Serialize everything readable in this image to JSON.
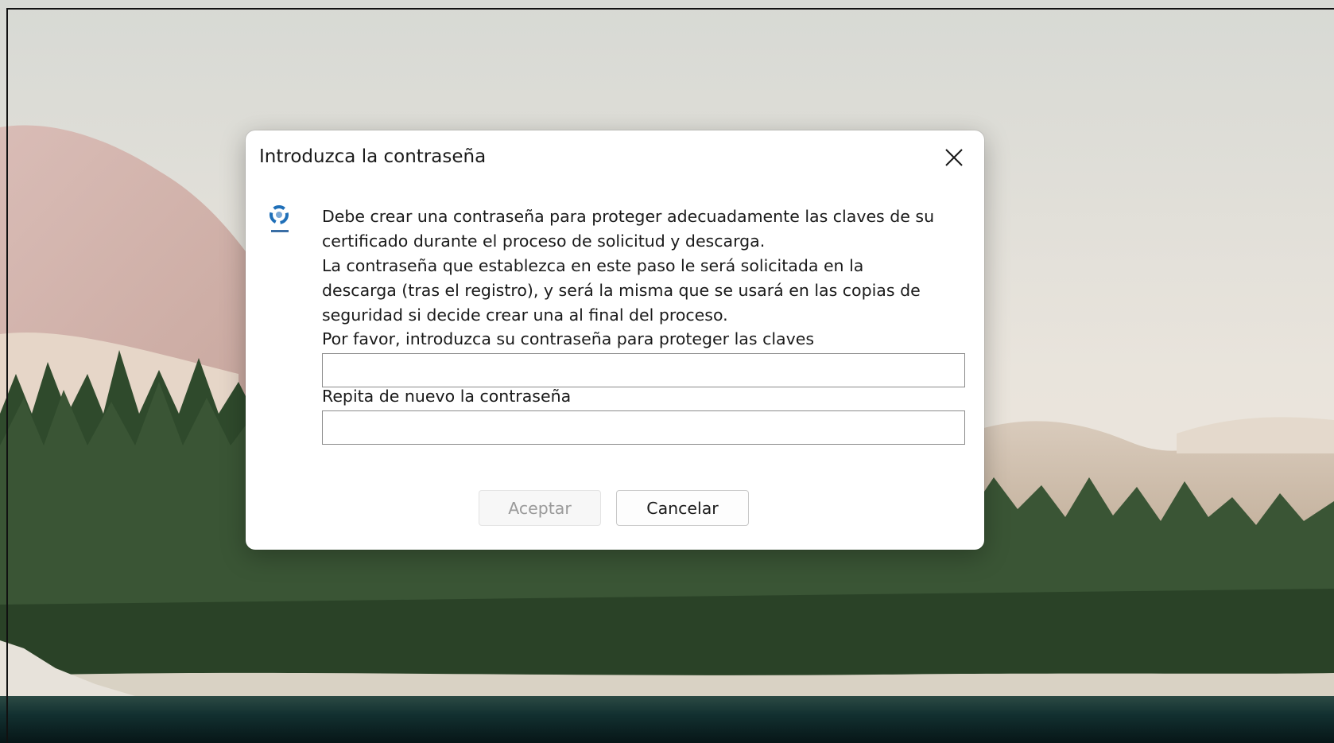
{
  "dialog": {
    "title": "Introduzca la contraseña",
    "close_icon": "close-icon",
    "app_icon": "certificate-app-icon",
    "message_lines": [
      "Debe crear una contraseña para proteger adecuadamente las claves de su",
      "certificado durante el proceso de solicitud y descarga.",
      "La contraseña que establezca en este paso le será solicitada en la",
      "descarga (tras el registro), y será la misma que se usará en las copias de",
      "seguridad si decide crear una al final del proceso."
    ],
    "password_label": "Por favor, introduzca su contraseña para proteger las claves",
    "password_value": "",
    "repeat_label": "Repita de nuevo la contraseña",
    "repeat_value": "",
    "accept_label": "Aceptar",
    "accept_enabled": false,
    "cancel_label": "Cancelar"
  },
  "colors": {
    "dialog_bg": "#ffffff",
    "text": "#1a1a1a",
    "disabled_text": "#9a9a9a",
    "icon_blue": "#1f6fb8"
  }
}
